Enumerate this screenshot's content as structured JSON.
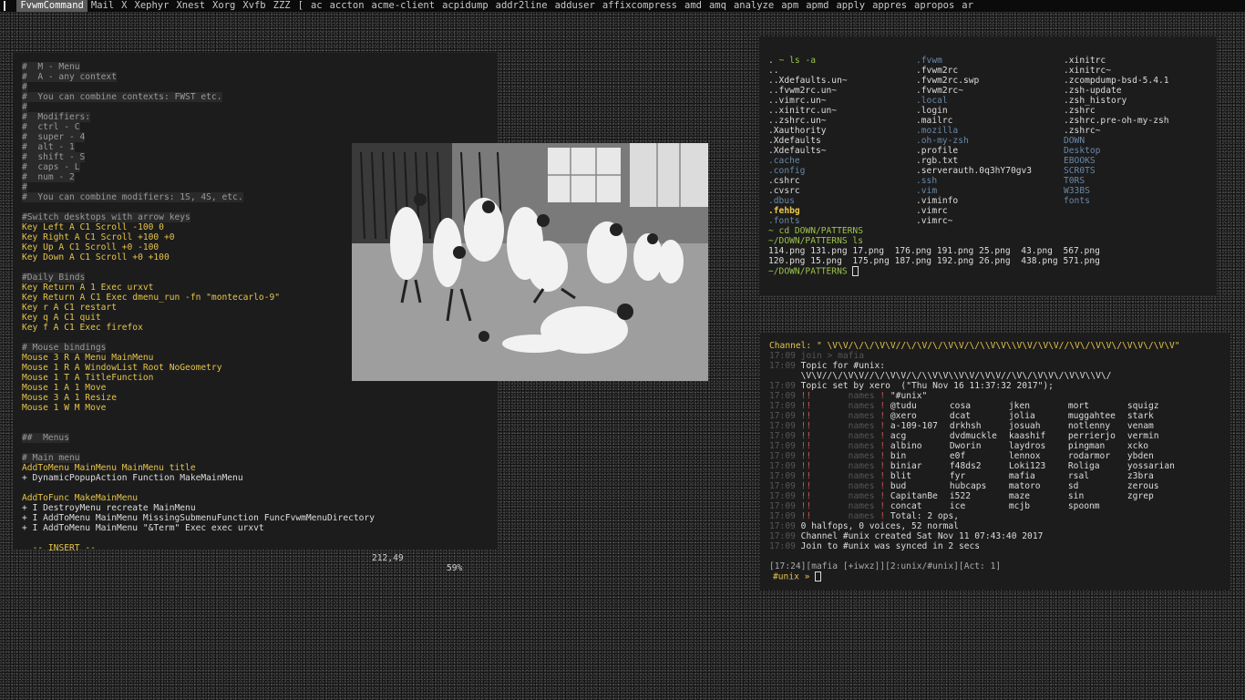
{
  "topbar": {
    "items": [
      "FvwmCommand",
      "Mail",
      "X",
      "Xephyr",
      "Xnest",
      "Xorg",
      "Xvfb",
      "ZZZ",
      "[",
      "ac",
      "accton",
      "acme-client",
      "acpidump",
      "addr2line",
      "adduser",
      "affixcompress",
      "amd",
      "amq",
      "analyze",
      "apm",
      "apmd",
      "apply",
      "appres",
      "apropos",
      "ar"
    ],
    "active_index": 0
  },
  "vim": {
    "lines": [
      {
        "t": "#  M - Menu",
        "c": "comment"
      },
      {
        "t": "#  A - any context",
        "c": "comment"
      },
      {
        "t": "#",
        "c": "comment"
      },
      {
        "t": "#  You can combine contexts: FWST etc.",
        "c": "comment"
      },
      {
        "t": "#",
        "c": "comment"
      },
      {
        "t": "#  Modifiers:",
        "c": "comment"
      },
      {
        "t": "#  ctrl - C",
        "c": "comment"
      },
      {
        "t": "#  super - 4",
        "c": "comment"
      },
      {
        "t": "#  alt - 1",
        "c": "comment"
      },
      {
        "t": "#  shift - S",
        "c": "comment"
      },
      {
        "t": "#  caps - L",
        "c": "comment"
      },
      {
        "t": "#  num - 2",
        "c": "comment"
      },
      {
        "t": "#",
        "c": "comment"
      },
      {
        "t": "#  You can combine modifiers: 1S, 4S, etc.",
        "c": "comment"
      },
      {
        "t": "",
        "c": ""
      },
      {
        "t": "#Switch desktops with arrow keys",
        "c": "comment"
      },
      {
        "t": "Key Left A C1 Scroll -100 0",
        "c": "key"
      },
      {
        "t": "Key Right A C1 Scroll +100 +0",
        "c": "key"
      },
      {
        "t": "Key Up A C1 Scroll +0 -100",
        "c": "key"
      },
      {
        "t": "Key Down A C1 Scroll +0 +100",
        "c": "key"
      },
      {
        "t": "",
        "c": ""
      },
      {
        "t": "#Daily Binds",
        "c": "comment"
      },
      {
        "t": "Key Return A 1 Exec urxvt",
        "c": "key"
      },
      {
        "t": "Key Return A C1 Exec dmenu_run -fn \"montecarlo-9\"",
        "c": "key"
      },
      {
        "t": "Key r A C1 restart",
        "c": "key"
      },
      {
        "t": "Key q A C1 quit",
        "c": "key"
      },
      {
        "t": "Key f A C1 Exec firefox",
        "c": "key"
      },
      {
        "t": "",
        "c": ""
      },
      {
        "t": "# Mouse bindings",
        "c": "comment"
      },
      {
        "t": "Mouse 3 R A Menu MainMenu",
        "c": "key"
      },
      {
        "t": "Mouse 1 R A WindowList Root NoGeometry",
        "c": "key"
      },
      {
        "t": "Mouse 1 T A TitleFunction",
        "c": "key"
      },
      {
        "t": "Mouse 1 A 1 Move",
        "c": "key"
      },
      {
        "t": "Mouse 3 A 1 Resize",
        "c": "key"
      },
      {
        "t": "Mouse 1 W M Move",
        "c": "key"
      },
      {
        "t": "",
        "c": ""
      },
      {
        "t": "",
        "c": ""
      },
      {
        "t": "##  Menus",
        "c": "comment"
      },
      {
        "t": "",
        "c": ""
      },
      {
        "t": "# Main menu",
        "c": "comment"
      },
      {
        "t": "AddToMenu MainMenu MainMenu title",
        "c": "key"
      },
      {
        "t": "+ DynamicPopupAction Function MakeMainMenu",
        "c": "plain"
      },
      {
        "t": "",
        "c": ""
      },
      {
        "t": "AddToFunc MakeMainMenu",
        "c": "key"
      },
      {
        "t": "+ I DestroyMenu recreate MainMenu",
        "c": "plain"
      },
      {
        "t": "+ I AddToMenu MainMenu MissingSubmenuFunction FuncFvwmMenuDirectory",
        "c": "plain"
      },
      {
        "t": "+ I AddToMenu MainMenu \"&Term\" Exec exec urxvt",
        "c": "plain"
      }
    ],
    "status_mode": "-- INSERT --",
    "status_pos": "212,49",
    "status_pct": "59%"
  },
  "ls": {
    "prompt_cmd": "~ ls -a",
    "col1": [
      ".",
      "..",
      "..Xdefaults.un~",
      "..fvwm2rc.un~",
      "..vimrc.un~",
      "..xinitrc.un~",
      "..zshrc.un~",
      ".Xauthority",
      ".Xdefaults",
      ".Xdefaults~",
      ".cache",
      ".config",
      ".cshrc",
      ".cvsrc",
      ".dbus",
      ".fehbg",
      ".fonts"
    ],
    "col2": [
      ".fvwm",
      ".fvwm2rc",
      ".fvwm2rc.swp",
      ".fvwm2rc~",
      ".local",
      ".login",
      ".mailrc",
      ".mozilla",
      ".oh-my-zsh",
      ".profile",
      ".rgb.txt",
      ".serverauth.0q3hY70gv3",
      ".ssh",
      ".vim",
      ".viminfo",
      ".vimrc",
      ".vimrc~"
    ],
    "col3": [
      ".xinitrc",
      ".xinitrc~",
      ".zcompdump-bsd-5.4.1",
      ".zsh-update",
      ".zsh_history",
      ".zshrc",
      ".zshrc.pre-oh-my-zsh",
      ".zshrc~",
      "DOWN",
      "Desktop",
      "EBOOKS",
      "SCR0TS",
      "T0RS",
      "W33BS",
      "fonts"
    ],
    "cd_cmd": "~ cd DOWN/PATTERNS",
    "ls2_prompt": "~/DOWN/PATTERNS ls",
    "files_row1": "114.png 131.png 17.png  176.png 191.png 25.png  43.png  567.png",
    "files_row2": "120.png 15.png  175.png 187.png 192.png 26.png  438.png 571.png",
    "final_prompt": "~/DOWN/PATTERNS"
  },
  "irc": {
    "channel_line": "Channel: \" \\V\\V/\\/\\/\\V\\V//\\/\\V/\\/\\V\\V/\\/\\\\V\\V\\\\V\\V/\\V\\V//\\V\\/\\V\\V\\/\\V\\V\\/\\V\\V\"",
    "join_line": [
      "17:09",
      "join > mafia"
    ],
    "topic_line": [
      "17:09",
      "Topic for #unix:"
    ],
    "topic_cont": "\\V\\V//\\/\\V\\V//\\/\\V\\V/\\/\\\\V\\V\\\\V\\V/\\V\\V//\\V\\/\\V\\V\\/\\V\\V\\\\V\\/",
    "topic_set": [
      "17:09",
      "Topic set by xero  (\"Thu Nov 16 11:37:32 2017\");"
    ],
    "names_header": [
      "17:09",
      "names",
      "\"#unix\""
    ],
    "names_rows": [
      [
        "@tudu",
        "cosa",
        "jken",
        "mort",
        "squigz"
      ],
      [
        "@xero",
        "dcat",
        "jolia",
        "muggahtee",
        "stark"
      ],
      [
        "a-109-107",
        "drkhsh",
        "josuah",
        "notlenny",
        "venam"
      ],
      [
        "acg",
        "dvdmuckle",
        "kaashif",
        "perrierjo",
        "vermin"
      ],
      [
        "albino",
        "Dworin",
        "laydros",
        "pingman",
        "xcko"
      ],
      [
        "bin",
        "e0f",
        "lennox",
        "rodarmor",
        "ybden"
      ],
      [
        "biniar",
        "f48ds2",
        "Loki123",
        "Roliga",
        "yossarian"
      ],
      [
        "blit",
        "fyr",
        "mafia",
        "rsal",
        "z3bra"
      ],
      [
        "bud",
        "hubcaps",
        "matoro",
        "sd",
        "zerous"
      ],
      [
        "CapitanBe",
        "i522",
        "maze",
        "sin",
        "zgrep"
      ],
      [
        "concat",
        "ice",
        "mcjb",
        "spoonm",
        ""
      ]
    ],
    "total_line": [
      "17:09",
      "Total: 2 ops,"
    ],
    "extra_lines": [
      [
        "17:09",
        "0 halfops, 0 voices, 52 normal"
      ],
      [
        "17:09",
        "Channel #unix created Sat Nov 11 07:43:40 2017"
      ],
      [
        "17:09",
        "Join to #unix was synced in 2 secs"
      ]
    ],
    "status_bar": "[17:24][mafia [+iwxz]][2:unix/#unix][Act: 1]",
    "input_prompt": "#unix »"
  },
  "colors": {
    "yellow": "#e6c44a",
    "green": "#9cc24a",
    "comment_bg": "#2a2a2a",
    "accent_red": "#cc5555"
  }
}
